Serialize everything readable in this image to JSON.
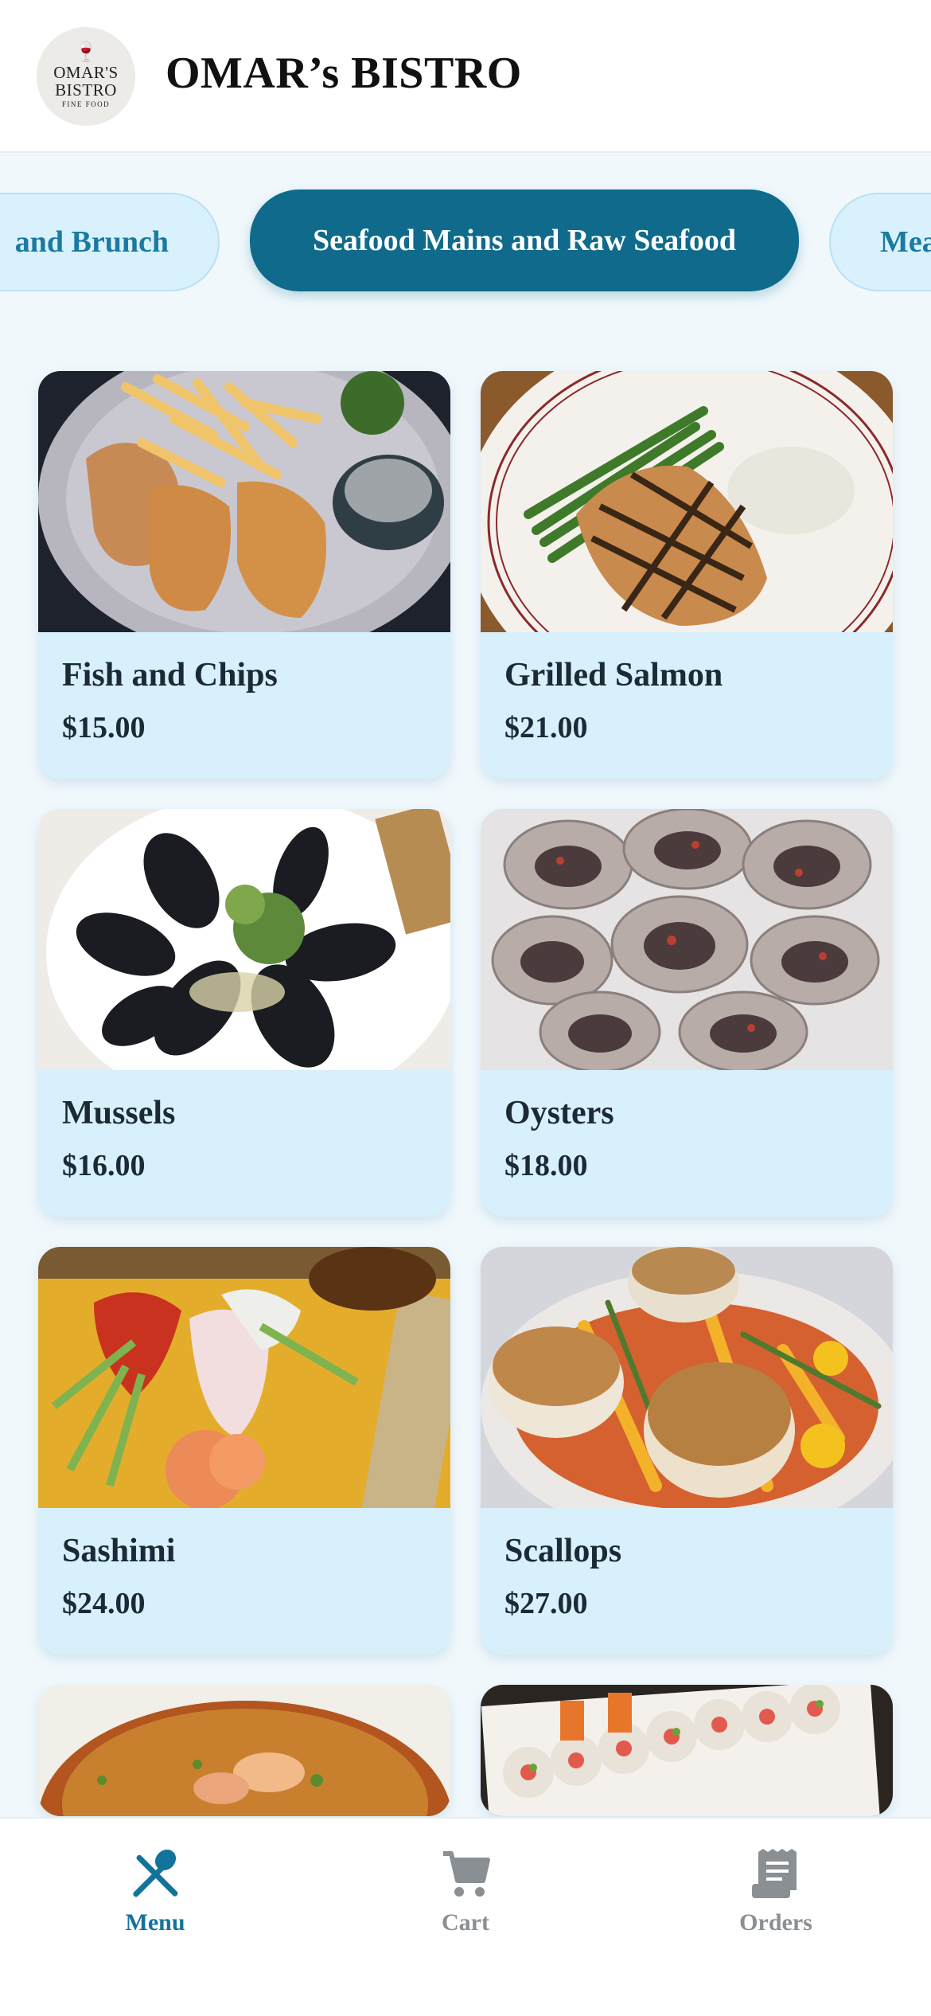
{
  "header": {
    "logo_line1": "OMAR'S",
    "logo_line2": "BISTRO",
    "logo_tagline": "FINE FOOD",
    "brand": "OMAR’s BISTRO"
  },
  "tabs": [
    {
      "label": "and Brunch",
      "active": false
    },
    {
      "label": "Seafood Mains and Raw Seafood",
      "active": true
    },
    {
      "label": "Mea",
      "active": false
    }
  ],
  "menu_items": [
    {
      "name": "Fish and Chips",
      "price": "$15.00"
    },
    {
      "name": "Grilled Salmon",
      "price": "$21.00"
    },
    {
      "name": "Mussels",
      "price": "$16.00"
    },
    {
      "name": "Oysters",
      "price": "$18.00"
    },
    {
      "name": "Sashimi",
      "price": "$24.00"
    },
    {
      "name": "Scallops",
      "price": "$27.00"
    }
  ],
  "bottom_nav": [
    {
      "label": "Menu",
      "icon": "utensils-icon",
      "active": true
    },
    {
      "label": "Cart",
      "icon": "cart-icon",
      "active": false
    },
    {
      "label": "Orders",
      "icon": "receipt-icon",
      "active": false
    }
  ],
  "colors": {
    "accent": "#0f6a8b",
    "card_bg": "#d7f0fc",
    "page_bg": "#f0f8fc",
    "inactive_nav": "#8a8f93"
  }
}
